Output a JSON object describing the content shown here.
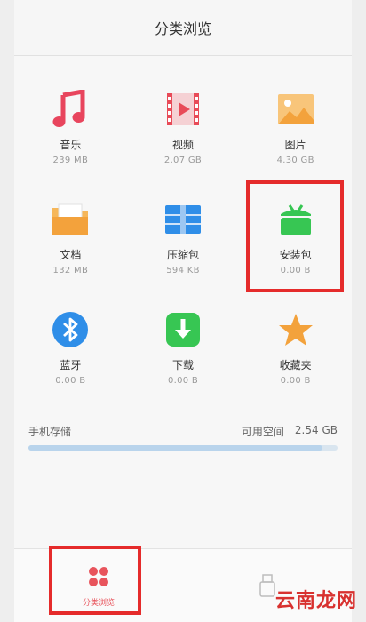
{
  "header": {
    "title": "分类浏览"
  },
  "categories": [
    {
      "name": "音乐",
      "size": "239 MB",
      "icon": "music-icon",
      "color": "#e8455d"
    },
    {
      "name": "视频",
      "size": "2.07 GB",
      "icon": "video-icon",
      "color": "#e84b58"
    },
    {
      "name": "图片",
      "size": "4.30 GB",
      "icon": "image-icon",
      "color": "#f3a23c"
    },
    {
      "name": "文档",
      "size": "132 MB",
      "icon": "folder-icon",
      "color": "#f3a23c"
    },
    {
      "name": "压缩包",
      "size": "594 KB",
      "icon": "archive-icon",
      "color": "#2f8ee8"
    },
    {
      "name": "安装包",
      "size": "0.00 B",
      "icon": "android-package-icon",
      "color": "#37c653"
    },
    {
      "name": "蓝牙",
      "size": "0.00 B",
      "icon": "bluetooth-icon",
      "color": "#2f8ee8"
    },
    {
      "name": "下载",
      "size": "0.00 B",
      "icon": "download-icon",
      "color": "#37c653"
    },
    {
      "name": "收藏夹",
      "size": "0.00 B",
      "icon": "star-icon",
      "color": "#f3a23c"
    }
  ],
  "storage": {
    "label": "手机存储",
    "available_label": "可用空间",
    "available_value": "2.54 GB",
    "used_fraction": 0.95
  },
  "bottom_nav": {
    "active_label": "分类浏览",
    "active_color": "#e8545c"
  },
  "watermark": "云南龙网",
  "highlight_color": "#e52b2b"
}
